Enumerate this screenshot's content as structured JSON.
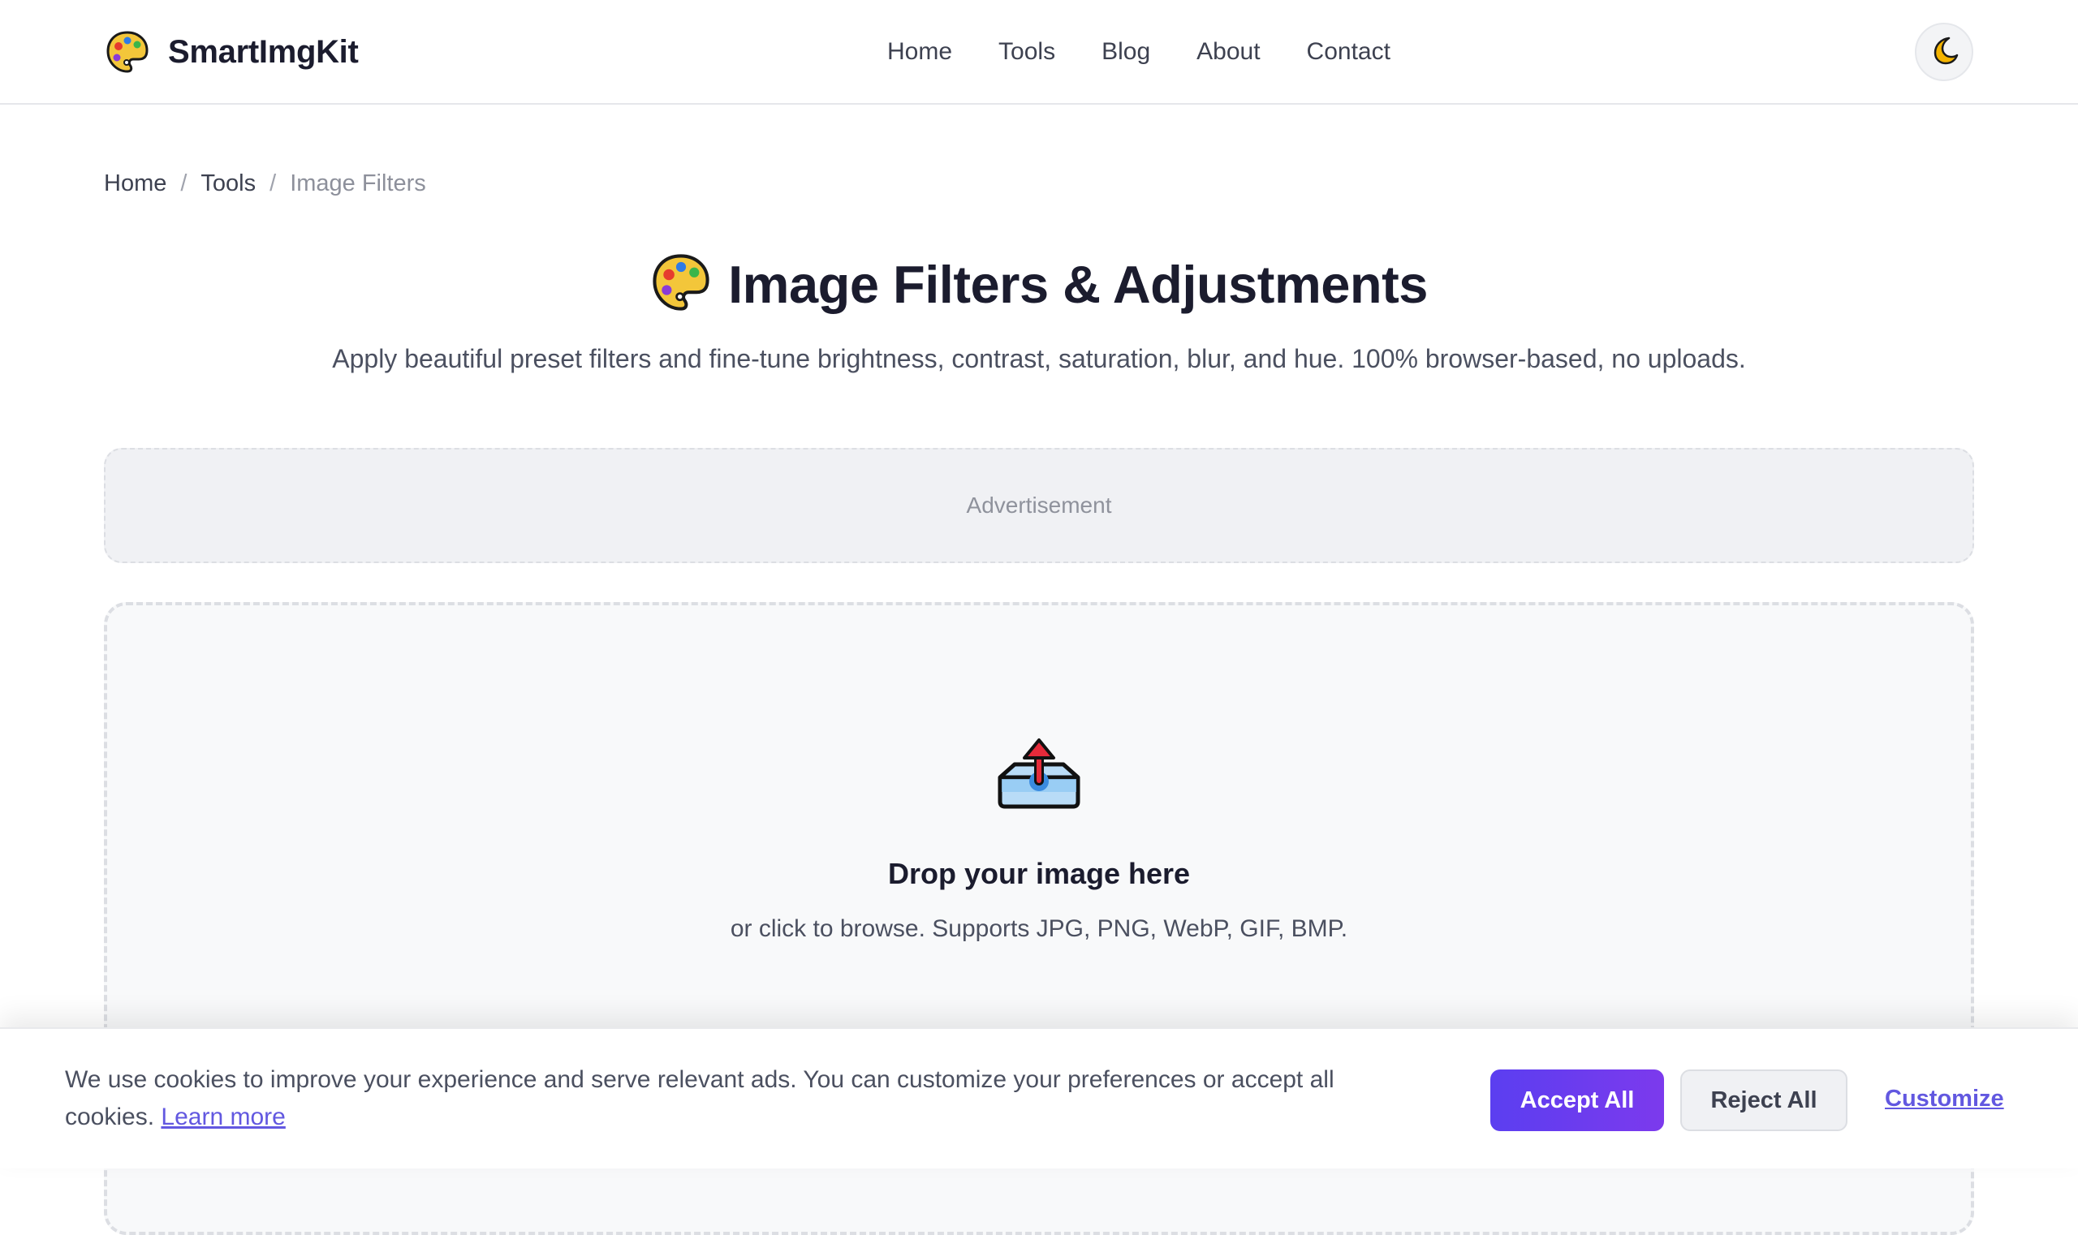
{
  "brand": {
    "name": "SmartImgKit",
    "logo_icon": "palette-icon"
  },
  "nav": {
    "items": [
      "Home",
      "Tools",
      "Blog",
      "About",
      "Contact"
    ]
  },
  "theme_toggle": {
    "icon": "moon-icon"
  },
  "breadcrumb": {
    "items": [
      "Home",
      "Tools"
    ],
    "separator": "/",
    "current": "Image Filters"
  },
  "hero": {
    "title": "Image Filters & Adjustments",
    "title_icon": "palette-icon",
    "subtitle": "Apply beautiful preset filters and fine-tune brightness, contrast, saturation, blur, and hue. 100% browser-based, no uploads."
  },
  "ad": {
    "label": "Advertisement"
  },
  "dropzone": {
    "icon": "upload-tray-icon",
    "title": "Drop your image here",
    "subtitle": "or click to browse. Supports JPG, PNG, WebP, GIF, BMP."
  },
  "cookie": {
    "text": "We use cookies to improve your experience and serve relevant ads. You can customize your preferences or accept all cookies.",
    "learn_more": "Learn more",
    "accept": "Accept All",
    "reject": "Reject All",
    "customize": "Customize"
  },
  "colors": {
    "accent": "#5b3ef0",
    "accent_end": "#7c3aed",
    "link": "#6258e0"
  }
}
